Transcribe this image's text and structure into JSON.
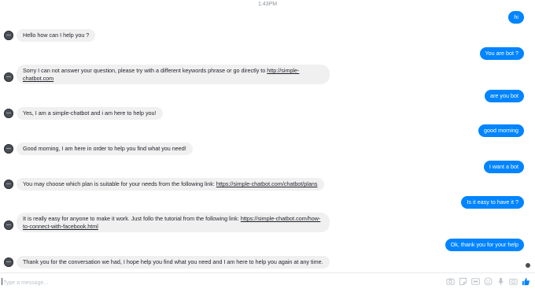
{
  "timestamp": "1:43PM",
  "messages": [
    {
      "from": "user",
      "text": "hi"
    },
    {
      "from": "bot",
      "text": "Hello how can I help you ?"
    },
    {
      "from": "user",
      "text": "You are bot ?"
    },
    {
      "from": "bot",
      "text": "Sorry I can not answer your question, please try with a different keywords phrase or go directly to ",
      "link": "http://simple-chatbot.com"
    },
    {
      "from": "user",
      "text": "are you bot"
    },
    {
      "from": "bot",
      "text": "Yes, I am a simple-chatbot and i am here to help you!"
    },
    {
      "from": "user",
      "text": "good morning"
    },
    {
      "from": "bot",
      "text": "Good morning, I am here in order to help you find what you need!"
    },
    {
      "from": "user",
      "text": "I want a bot"
    },
    {
      "from": "bot",
      "text": "You may choose which plan is suitable for your needs from the following link: ",
      "link": "https://simple-chatbot.com/chatbot/plans"
    },
    {
      "from": "user",
      "text": "Is it easy to have it ?"
    },
    {
      "from": "bot",
      "text": "It is really easy for anyone to make it work. Just follo the tutorial from the following link: ",
      "link": "https://simple-chatbot.com/how-to-connect-with-facebook.html"
    },
    {
      "from": "user",
      "text": "Ok, thank you for your help"
    },
    {
      "from": "bot",
      "text": "Thank you for the conversation we had, I hope help you find what you need and I am here to help you again at any time."
    }
  ],
  "composer": {
    "placeholder": "Type a message...",
    "tools": [
      "camera-icon",
      "sticker-icon",
      "gif-icon",
      "emoji-icon",
      "microphone-icon",
      "photo-icon",
      "like-icon"
    ]
  },
  "colors": {
    "user_bubble": "#0084ff",
    "bot_bubble": "#f1f0f0",
    "accent": "#0084ff"
  }
}
